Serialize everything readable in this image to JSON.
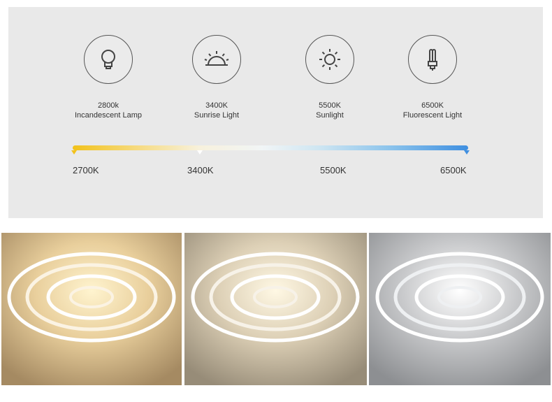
{
  "icons": [
    {
      "name": "incandescent-lamp-icon",
      "line1": "2800k",
      "line2": "Incandescent Lamp"
    },
    {
      "name": "sunrise-icon",
      "line1": "3400K",
      "line2": "Sunrise Light"
    },
    {
      "name": "sun-icon",
      "line1": "5500K",
      "line2": "Sunlight"
    },
    {
      "name": "fluorescent-tube-icon",
      "line1": "6500K",
      "line2": "Fluorescent Light"
    }
  ],
  "scale": {
    "labels": [
      "2700K",
      "3400K",
      "5500K",
      "6500K"
    ],
    "tick_colors": [
      "#f2c21b",
      "#ffffff",
      "#ffffff",
      "#3f8fe0"
    ]
  },
  "photos": [
    {
      "name": "warm-light-photo",
      "wall": "#c9a97a",
      "glow": "#fff4cf"
    },
    {
      "name": "neutral-light-photo",
      "wall": "#b8a98e",
      "glow": "#fff8e4"
    },
    {
      "name": "cool-light-photo",
      "wall": "#a4a6a8",
      "glow": "#ffffff"
    }
  ]
}
